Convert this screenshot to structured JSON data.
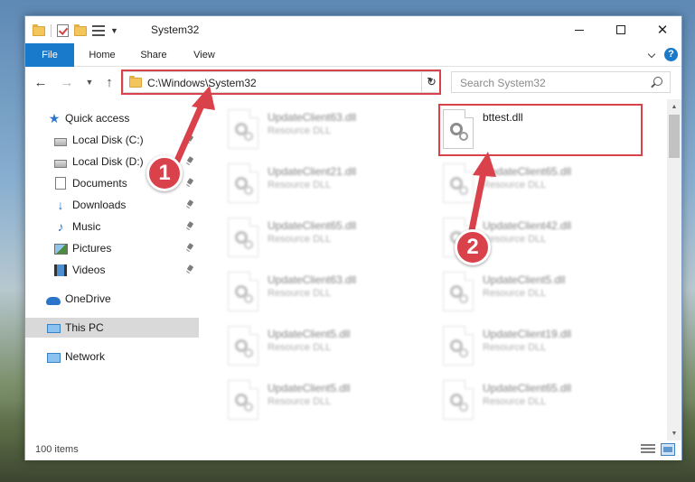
{
  "window": {
    "title": "System32",
    "min_glyph": "",
    "close_glyph": "✕"
  },
  "ribbon": {
    "tabs": [
      "File",
      "Home",
      "Share",
      "View"
    ],
    "help_glyph": "?"
  },
  "nav": {
    "back_glyph": "←",
    "forward_glyph": "→",
    "recent_glyph": "▼",
    "up_glyph": "↑",
    "address": "C:\\Windows\\System32",
    "address_drop_glyph": "▼",
    "refresh_glyph": "↻",
    "search_placeholder": "Search System32"
  },
  "sidebar": {
    "items": [
      {
        "label": "Quick access",
        "icon": "star-icon",
        "pinned": false
      },
      {
        "label": "Local Disk (C:)",
        "icon": "disk-icon",
        "pinned": true
      },
      {
        "label": "Local Disk (D:)",
        "icon": "disk-icon",
        "pinned": true
      },
      {
        "label": "Documents",
        "icon": "documents-icon",
        "pinned": true
      },
      {
        "label": "Downloads",
        "icon": "download-arrow-icon",
        "pinned": true
      },
      {
        "label": "Music",
        "icon": "music-note-icon",
        "pinned": true
      },
      {
        "label": "Pictures",
        "icon": "pictures-icon",
        "pinned": true
      },
      {
        "label": "Videos",
        "icon": "videos-icon",
        "pinned": true
      },
      {
        "label": "OneDrive",
        "icon": "cloud-icon",
        "pinned": false
      },
      {
        "label": "This PC",
        "icon": "computer-icon",
        "pinned": false,
        "selected": true
      },
      {
        "label": "Network",
        "icon": "network-icon",
        "pinned": false
      }
    ],
    "star_glyph": "★",
    "down_glyph": "↓",
    "music_glyph": "♪"
  },
  "files": [
    {
      "name": "UpdateClient63.dll",
      "type": "Resource DLL"
    },
    {
      "name": "bttest.dll",
      "type": ""
    },
    {
      "name": "UpdateClient21.dll",
      "type": "Resource DLL"
    },
    {
      "name": "UpdateClient65.dll",
      "type": "Resource DLL"
    },
    {
      "name": "UpdateClient65.dll",
      "type": "Resource DLL"
    },
    {
      "name": "UpdateClient42.dll",
      "type": "Resource DLL"
    },
    {
      "name": "UpdateClient63.dll",
      "type": "Resource DLL"
    },
    {
      "name": "UpdateClient5.dll",
      "type": "Resource DLL"
    },
    {
      "name": "UpdateClient5.dll",
      "type": "Resource DLL"
    },
    {
      "name": "UpdateClient19.dll",
      "type": "Resource DLL"
    },
    {
      "name": "UpdateClient5.dll",
      "type": "Resource DLL"
    },
    {
      "name": "UpdateClient65.dll",
      "type": "Resource DLL"
    }
  ],
  "scrollbar": {
    "up_glyph": "▲",
    "down_glyph": "▼"
  },
  "status": {
    "item_count": "100 items"
  },
  "annotations": {
    "step1": "1",
    "step2": "2",
    "highlight_color": "#d9414b"
  }
}
